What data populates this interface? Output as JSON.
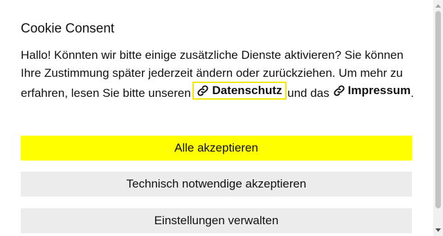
{
  "dialog": {
    "title": "Cookie Consent",
    "text_before": "Hallo! Könnten wir bitte einige zusätzliche Dienste aktivieren? Sie können Ihre Zustimmung später jederzeit ändern oder zurückziehen. Um mehr zu erfahren, lesen Sie bitte unseren",
    "privacy_link": "Datenschutz",
    "text_between": "und das",
    "imprint_link": "Impressum",
    "text_after": ".",
    "link_icon": "link-icon"
  },
  "buttons": {
    "accept_all": "Alle akzeptieren",
    "accept_necessary": "Technisch notwendige akzeptieren",
    "manage_settings": "Einstellungen verwalten"
  },
  "colors": {
    "primary_button": "#ffff00",
    "secondary_button": "#ececec",
    "focus_outline": "#f1e800"
  }
}
